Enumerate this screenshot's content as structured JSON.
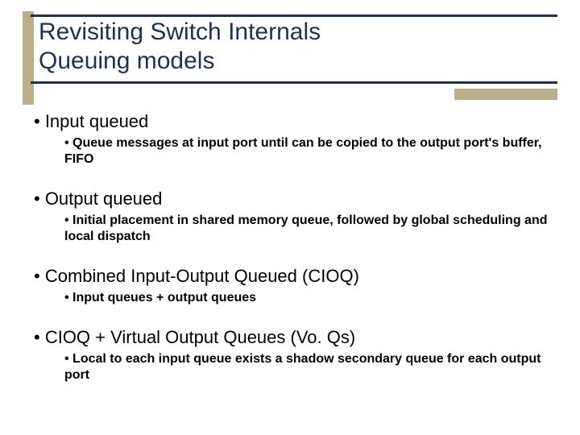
{
  "title": {
    "line1": "Revisiting Switch Internals",
    "line2": "Queuing models"
  },
  "bullets": [
    {
      "label": "• Input queued",
      "sub": "• Queue messages at input port until can be copied to the output port's buffer, FIFO"
    },
    {
      "label": "• Output queued",
      "sub": "• Initial placement in shared memory queue, followed by global scheduling and local dispatch"
    },
    {
      "label": "• Combined Input-Output Queued (CIOQ)",
      "sub": "• Input queues + output queues"
    },
    {
      "label": "• CIOQ + Virtual Output Queues (Vo. Qs)",
      "sub": "• Local to each input queue exists a shadow secondary queue for each output port"
    }
  ]
}
